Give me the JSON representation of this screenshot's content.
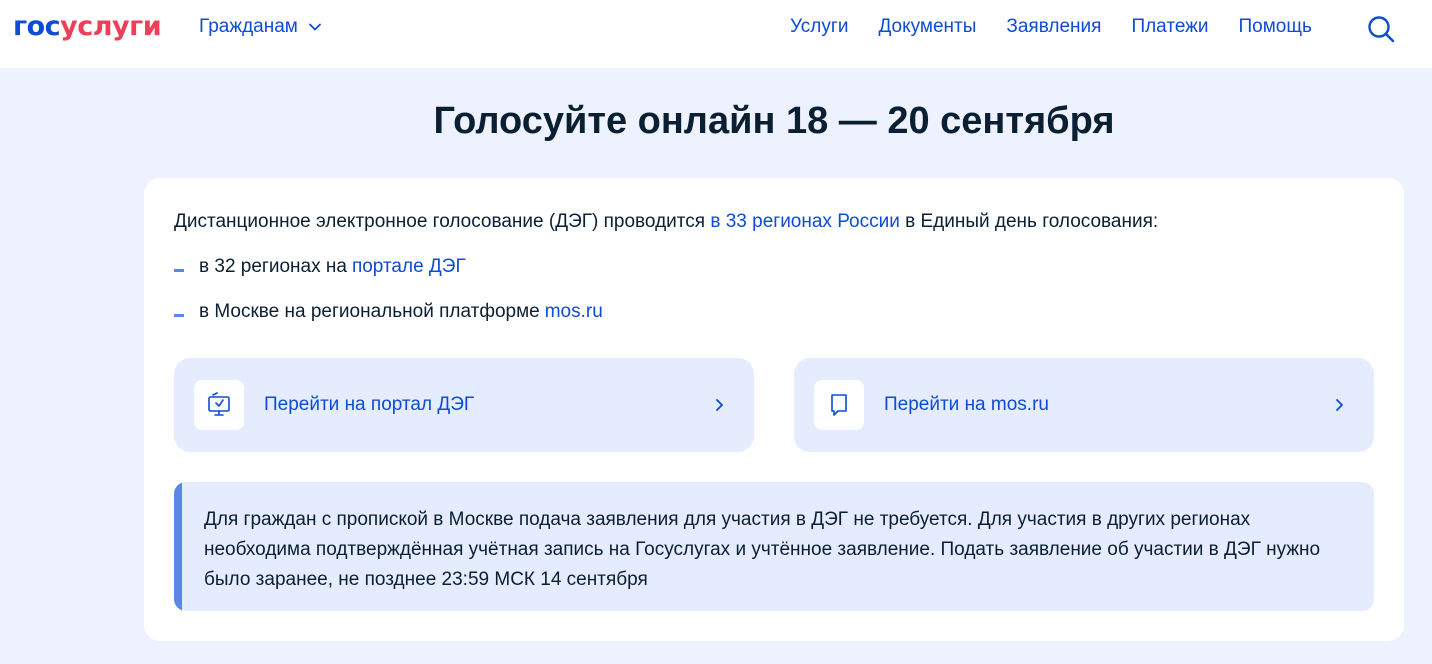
{
  "header": {
    "logo_part1": "гос",
    "logo_part2": "услуги",
    "citizens_menu": "Гражданам",
    "nav": [
      "Услуги",
      "Документы",
      "Заявления",
      "Платежи",
      "Помощь"
    ]
  },
  "page_title": "Голосуйте онлайн 18 — 20 сентября",
  "intro": {
    "text_before": "Дистанционное электронное голосование (ДЭГ) проводится ",
    "link": "в 33 регионах России",
    "text_after": " в Единый день голосования:"
  },
  "bullets": [
    {
      "text": "в 32 регионах на ",
      "link": "портале ДЭГ"
    },
    {
      "text": "в Москве на региональной платформе ",
      "link": "mos.ru"
    }
  ],
  "actions": [
    {
      "label": "Перейти на портал ДЭГ",
      "icon": "ballot-box-icon"
    },
    {
      "label": "Перейти на mos.ru",
      "icon": "bookmark-icon"
    }
  ],
  "notice": "Для граждан с пропиской в Москве подача заявления для участия в ДЭГ не требуется. Для участия в других регионах необходима подтверждённая учётная запись на Госуслугах и учтённое заявление. Подать заявление об участии в ДЭГ нужно было заранее, не позднее 23:59 МСК 14 сентября",
  "colors": {
    "brand_blue": "#0d4cd3",
    "brand_red": "#ee3f58",
    "page_bg": "#edf2fe",
    "accent_bar": "#5b88e8"
  }
}
